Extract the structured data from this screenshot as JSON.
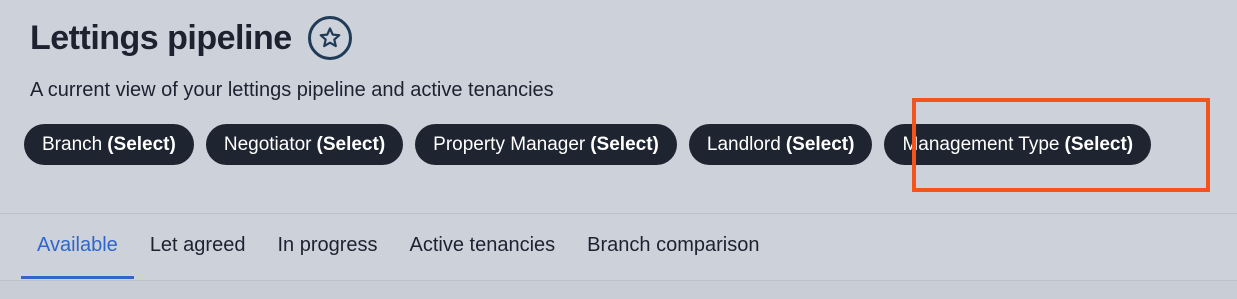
{
  "header": {
    "title": "Lettings pipeline",
    "subtitle": "A current view of your lettings pipeline and active tenancies",
    "favorite_icon": "star-icon"
  },
  "filters": [
    {
      "label": "Branch",
      "value": "(Select)"
    },
    {
      "label": "Negotiator",
      "value": "(Select)"
    },
    {
      "label": "Property Manager",
      "value": "(Select)"
    },
    {
      "label": "Landlord",
      "value": "(Select)"
    },
    {
      "label": "Management Type",
      "value": "(Select)"
    }
  ],
  "tabs": [
    {
      "label": "Available",
      "active": true
    },
    {
      "label": "Let agreed",
      "active": false
    },
    {
      "label": "In progress",
      "active": false
    },
    {
      "label": "Active tenancies",
      "active": false
    },
    {
      "label": "Branch comparison",
      "active": false
    }
  ],
  "colors": {
    "background": "#cdd1da",
    "pill": "#1f2431",
    "accent": "#2f66c9",
    "highlight": "#f2541b",
    "star_outline": "#1f3b57"
  }
}
